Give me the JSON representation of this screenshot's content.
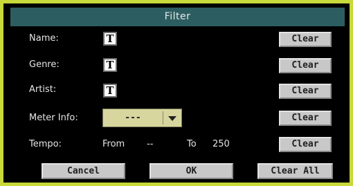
{
  "dialog": {
    "title": "Filter"
  },
  "fields": {
    "name_label": "Name:",
    "genre_label": "Genre:",
    "artist_label": "Artist:",
    "meter_label": "Meter Info:",
    "tempo_label": "Tempo:",
    "text_icon_glyph": "T"
  },
  "meter": {
    "value": "---"
  },
  "tempo": {
    "from_label": "From",
    "from_value": "--",
    "to_label": "To",
    "to_value": "250"
  },
  "buttons": {
    "clear": "Clear",
    "cancel": "Cancel",
    "ok": "OK",
    "clear_all": "Clear All"
  },
  "icons": {
    "name_edit": "text-edit-icon",
    "genre_edit": "text-edit-icon",
    "artist_edit": "text-edit-icon",
    "meter_dropdown": "chevron-down-icon"
  },
  "colors": {
    "frame": "#c9d83a",
    "title_bar": "#2c5e61",
    "dialog_bg": "#000000",
    "button": "#c8c8c8",
    "select_bg": "#d7d69e"
  }
}
